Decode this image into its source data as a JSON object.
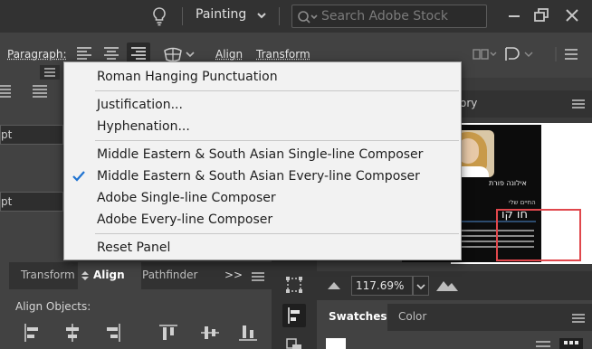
{
  "titlebar": {
    "workspace": "Painting",
    "search_placeholder": "Search Adobe Stock"
  },
  "controlbar": {
    "paragraph_label": "Paragraph:",
    "align_label": "Align",
    "transform_label": "Transform"
  },
  "leftpanel": {
    "field1": "pt",
    "field2": "pt"
  },
  "menu": {
    "items": [
      {
        "label": "Roman Hanging Punctuation",
        "checked": false
      },
      {
        "label": "Justification...",
        "checked": false
      },
      {
        "label": "Hyphenation...",
        "checked": false
      },
      {
        "label": "Middle Eastern & South Asian Single-line Composer",
        "checked": false
      },
      {
        "label": "Middle Eastern & South Asian Every-line Composer",
        "checked": true
      },
      {
        "label": "Adobe Single-line Composer",
        "checked": false
      },
      {
        "label": "Adobe Every-line Composer",
        "checked": false
      },
      {
        "label": "Reset Panel",
        "checked": false
      }
    ]
  },
  "document": {
    "tab_label": "ory",
    "card_name": "אילונה פורת",
    "card_subtitle": "החיים שלי",
    "card_big": "חו קו",
    "zoom": "117.69%"
  },
  "alignpanel": {
    "tabs": [
      "Transform",
      "Align",
      "Pathfinder"
    ],
    "active_tab": "Align",
    "overflow": ">>",
    "section_label": "Align Objects:"
  },
  "swatches": {
    "tabs": [
      "Swatches",
      "Color"
    ],
    "active_tab": "Swatches"
  },
  "colors": {
    "menu_bg": "#f2f2f2",
    "check_blue": "#1f73d1",
    "highlight_red": "#e0474c",
    "panel": "#424242",
    "titlebar": "#323232"
  }
}
